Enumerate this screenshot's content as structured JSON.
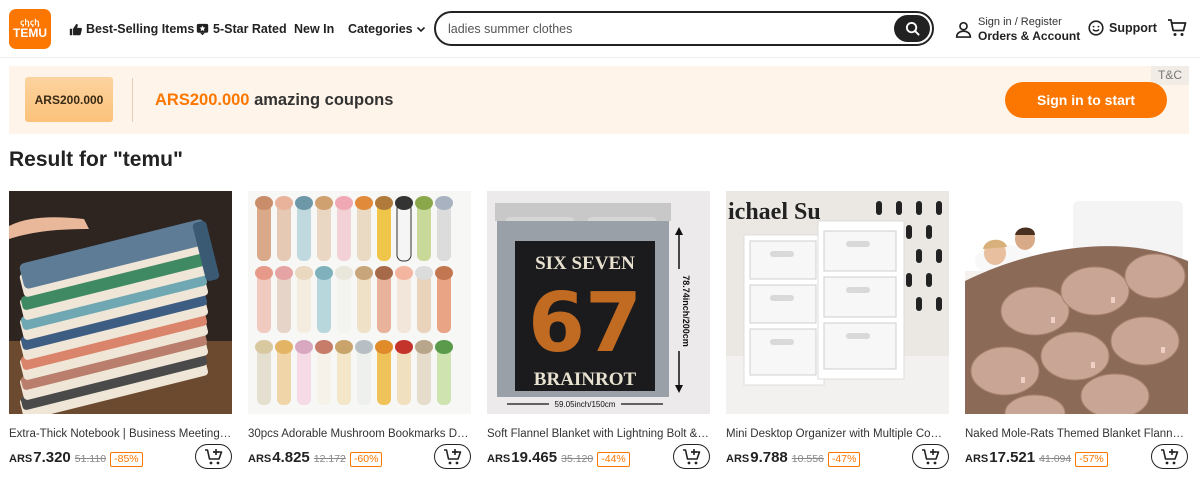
{
  "header": {
    "logo": {
      "top": "ꞔꞕꞔꞕ",
      "text": "TEMU"
    },
    "nav": {
      "best_selling": "Best-Selling Items",
      "five_star": "5-Star Rated",
      "new_in": "New In",
      "categories": "Categories"
    },
    "search": {
      "value": "ladies summer clothes"
    },
    "account": {
      "line1": "Sign in / Register",
      "line2": "Orders & Account"
    },
    "support": "Support"
  },
  "banner": {
    "ticket": "ARS200.000",
    "amount": "ARS200.000",
    "text": " amazing coupons",
    "tc": "T&C",
    "cta": "Sign in to start"
  },
  "results": {
    "title": "Result for \"temu\""
  },
  "products": [
    {
      "name": "Extra-Thick Notebook | Business Meeting ...",
      "currency": "ARS",
      "price": "7.320",
      "old_price": "51.110",
      "discount": "-85%"
    },
    {
      "name": "30pcs Adorable Mushroom Bookmarks De...",
      "currency": "ARS",
      "price": "4.825",
      "old_price": "12.172",
      "discount": "-60%"
    },
    {
      "name": "Soft Flannel Blanket with Lightning Bolt & ...",
      "currency": "ARS",
      "price": "19.465",
      "old_price": "35.120",
      "discount": "-44%",
      "image_text": {
        "line1": "SIX SEVEN",
        "big": "67",
        "line2": "BRAINROT",
        "height": "78.74inch/200cm",
        "width": "59.05inch/150cm"
      }
    },
    {
      "name": "Mini Desktop Organizer with Multiple Com...",
      "currency": "ARS",
      "price": "9.788",
      "old_price": "10.556",
      "discount": "-47%",
      "image_text": {
        "wall": "ichael Su"
      }
    },
    {
      "name": "Naked Mole-Rats Themed Blanket Flannel ...",
      "currency": "ARS",
      "price": "17.521",
      "old_price": "41.094",
      "discount": "-57%"
    }
  ],
  "colors": {
    "brand": "#fb7701",
    "banner_bg": "#fff4e9",
    "text": "#222222"
  }
}
